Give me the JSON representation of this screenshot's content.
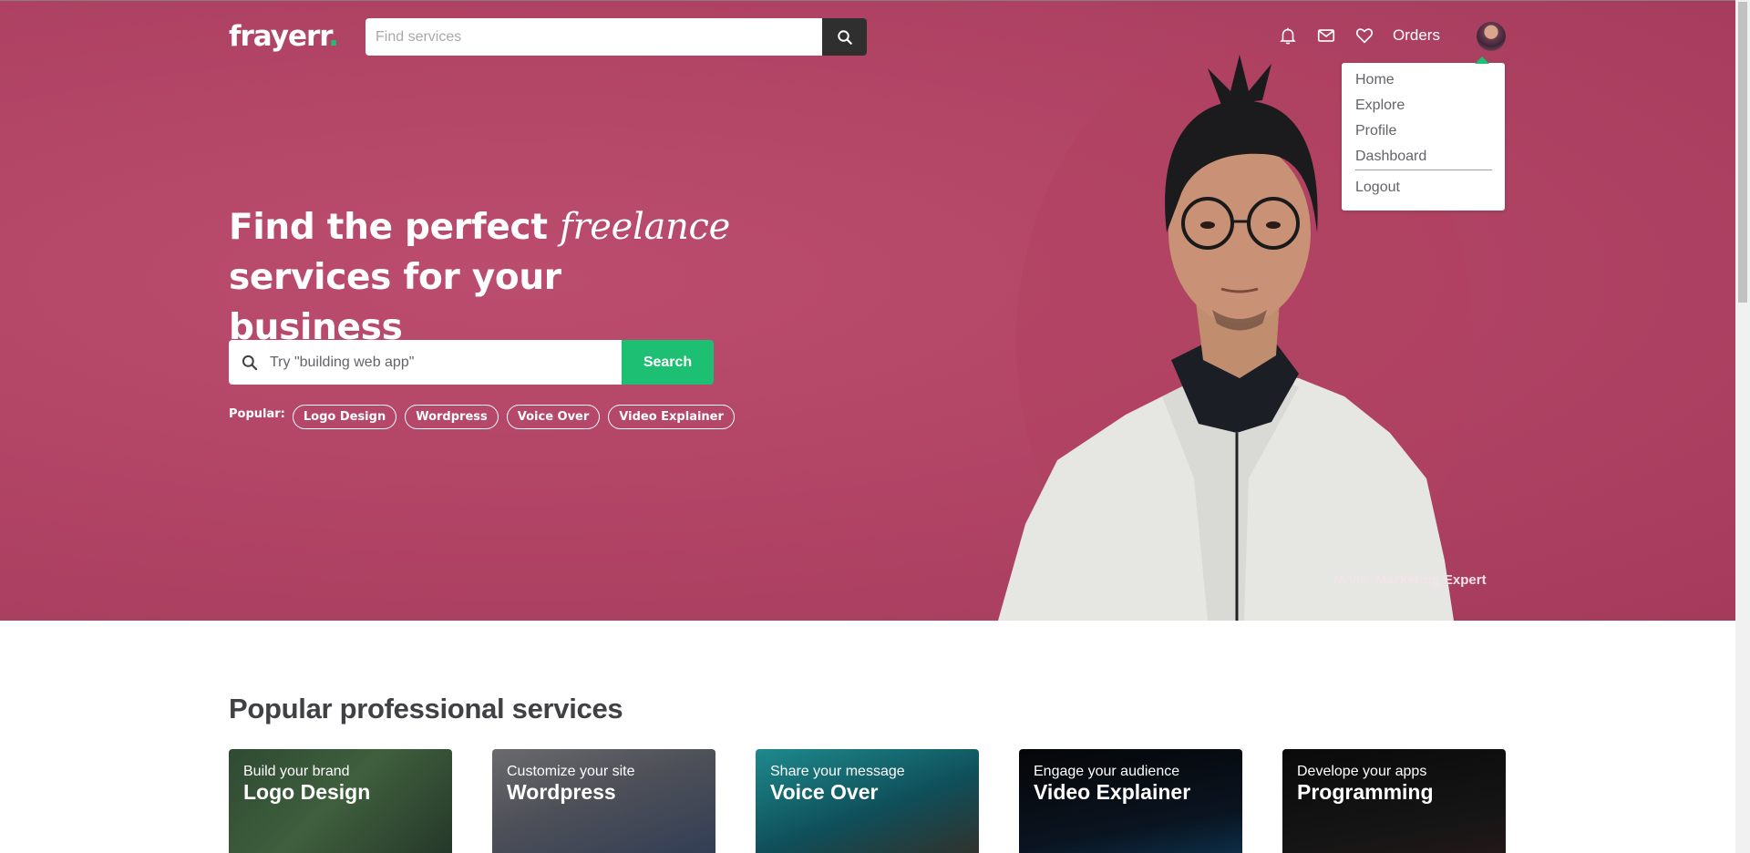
{
  "header": {
    "logo_text": "frayerr",
    "logo_dot": ".",
    "search_placeholder": "Find services",
    "orders_label": "Orders"
  },
  "user_menu": {
    "items": [
      "Home",
      "Explore",
      "Profile",
      "Dashboard"
    ],
    "logout_label": "Logout"
  },
  "hero": {
    "title_part1": "Find the perfect ",
    "title_italic": "freelance",
    "title_part2": "services for your business",
    "search_placeholder": "Try \"building web app\"",
    "search_button": "Search",
    "popular_label": "Popular:",
    "popular_tags": [
      "Logo Design",
      "Wordpress",
      "Voice Over",
      "Video Explainer"
    ],
    "caption_name": "Moon,",
    "caption_role": "Marketing Expert"
  },
  "services": {
    "title": "Popular professional services",
    "cards": [
      {
        "sub": "Build your brand",
        "name": "Logo Design"
      },
      {
        "sub": "Customize your site",
        "name": "Wordpress"
      },
      {
        "sub": "Share your message",
        "name": "Voice Over"
      },
      {
        "sub": "Engage your audience",
        "name": "Video Explainer"
      },
      {
        "sub": "Develope your apps",
        "name": "Programming"
      }
    ]
  },
  "colors": {
    "hero_bg": "#b34667",
    "accent_green": "#1dbf73",
    "search_button_dark": "#2f2f2f"
  },
  "icons": [
    "search-icon",
    "bell-icon",
    "mail-icon",
    "heart-icon"
  ]
}
